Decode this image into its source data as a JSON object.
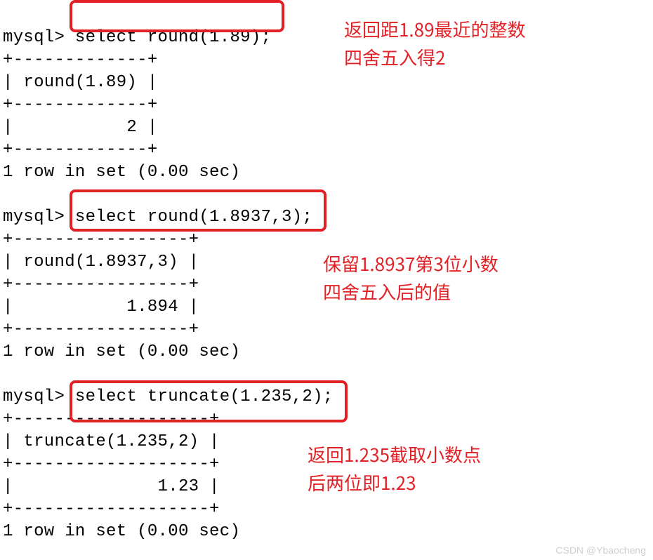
{
  "terminal": {
    "q1": {
      "prompt": "mysql>",
      "cmd": " select round(1.89);",
      "sep": "+-------------+",
      "header": "| round(1.89) |",
      "value": "|           2 |",
      "footer": "1 row in set (0.00 sec)"
    },
    "q2": {
      "prompt": "mysql>",
      "cmd": " select round(1.8937,3);",
      "sep": "+-----------------+",
      "header": "| round(1.8937,3) |",
      "value": "|           1.894 |",
      "footer": "1 row in set (0.00 sec)"
    },
    "q3": {
      "prompt": "mysql>",
      "cmd": " select truncate(1.235,2);",
      "sep": "+-------------------+",
      "header": "| truncate(1.235,2) |",
      "value": "|              1.23 |",
      "footer": "1 row in set (0.00 sec)"
    },
    "blank": " "
  },
  "annotations": {
    "a1_l1": "返回距1.89最近的整数",
    "a1_l2": "四舍五入得2",
    "a2_l1": "保留1.8937第3位小数",
    "a2_l2": "四舍五入后的值",
    "a3_l1": "返回1.235截取小数点",
    "a3_l2": "后两位即1.23"
  },
  "watermark": "CSDN @Ybaocheng"
}
